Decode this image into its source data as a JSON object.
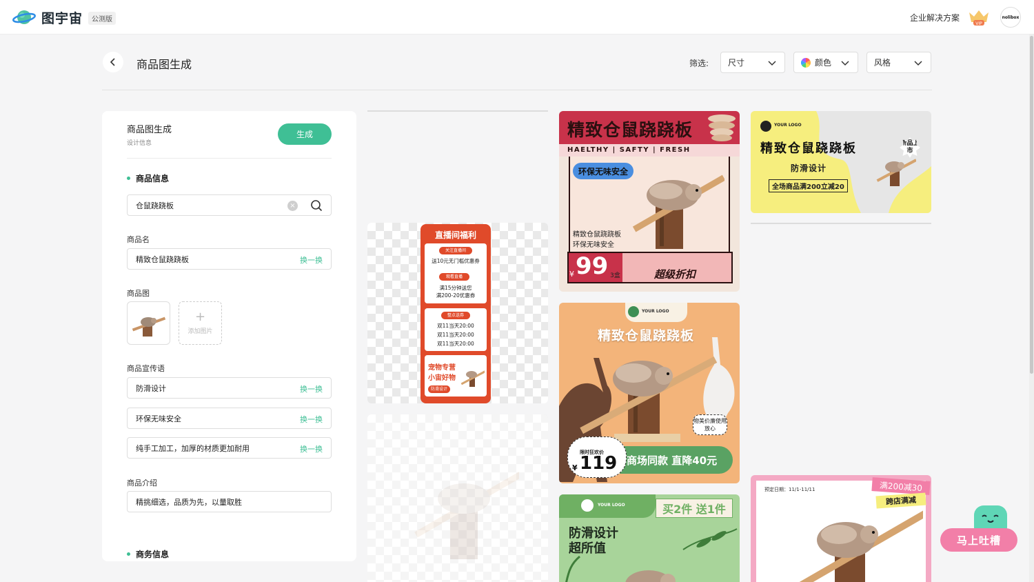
{
  "app": {
    "name": "图宇宙",
    "badge": "公测版",
    "enterprise_link": "企业解决方案",
    "avatar_text": "nolibox"
  },
  "header": {
    "title": "商品图生成",
    "filter_label": "筛选:",
    "filters": [
      {
        "label": "尺寸"
      },
      {
        "label": "颜色"
      },
      {
        "label": "风格"
      }
    ]
  },
  "panel": {
    "title": "商品图生成",
    "subtitle": "设计信息",
    "generate_label": "生成",
    "product_section": "商品信息",
    "search_value": "仓鼠跷跷板",
    "name_label": "商品名",
    "name_value": "精致仓鼠跷跷板",
    "swap_label": "换一换",
    "image_label": "商品图",
    "add_image_label": "添加图片",
    "slogan_label": "商品宣传语",
    "slogans": [
      "防滑设计",
      "环保无味安全",
      "纯手工加工，加厚的材质更加耐用"
    ],
    "intro_label": "商品介绍",
    "intro_value": "精挑细选，品质为先，以量取胜",
    "business_section": "商务信息"
  },
  "cards": {
    "red_poster": {
      "title": "精致仓鼠跷跷板",
      "strip": "HAELTHY | SAFTY | FRESH",
      "badge": "环保无味安全",
      "line1": "精致仓鼠跷跷板",
      "line2": "环保无味安全",
      "currency": "¥",
      "price": "99",
      "unit": "3盒",
      "promo": "超级折扣"
    },
    "gray_banner": {
      "logo": "YOUR LOGO",
      "title": "精致仓鼠跷跷板",
      "sub": "防滑设计",
      "promo": "全场商品满200立减20",
      "new_badge": "新品上市"
    },
    "live_list": {
      "title": "直播间福利",
      "tag1": "关注直播间",
      "text1": "送10元无门槛优惠券",
      "tag2": "观看直播",
      "text2a": "满15分钟送您",
      "text2b": "满200-20优惠券",
      "tag3": "整点送券",
      "times": [
        "双11当天20:00",
        "双11当天20:00",
        "双11当天20:00"
      ],
      "brand1": "宠物专营",
      "brand2": "小宙好物",
      "brand_tag": "防滑设计"
    },
    "orange_poster": {
      "logo": "YOUR LOGO",
      "title": "精致仓鼠跷跷板",
      "bubble": "物美价廉使用放心",
      "price_tag": "限时狂欢价",
      "currency": "¥",
      "price": "119",
      "promo": "商场同款 直降40元"
    },
    "green_poster": {
      "logo": "YOUR LOGO",
      "badge": "买2件 送1件",
      "line1": "防滑设计",
      "line2": "超所值"
    },
    "pink_poster": {
      "date": "预定日期：11/1-11/11",
      "tag1": "满200减30",
      "tag2": "跨店满减"
    }
  },
  "feedback": {
    "label": "马上吐槽"
  },
  "colors": {
    "accent": "#3fbf95",
    "red": "#c8324a",
    "orange": "#f3b47a",
    "green": "#a8d49a",
    "pink": "#f27fa8"
  },
  "icons": [
    "planet-logo-icon",
    "crown-vip-icon",
    "chevron-left-icon",
    "chevron-down-icon",
    "color-wheel-icon",
    "clear-icon",
    "search-icon",
    "plus-icon"
  ]
}
